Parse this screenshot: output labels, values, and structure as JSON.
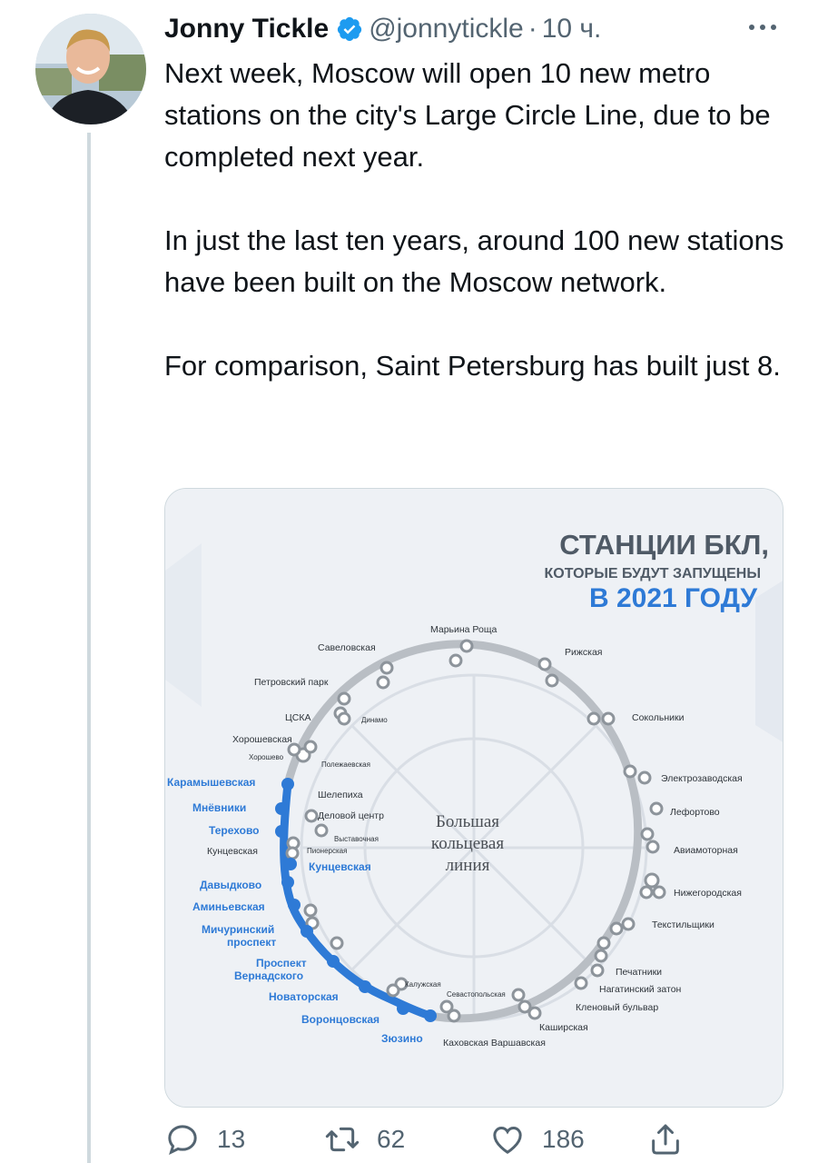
{
  "tweet": {
    "author_name": "Jonny Tickle",
    "handle": "@jonnytickle",
    "separator": "·",
    "time": "10 ч.",
    "paragraphs": [
      "Next week, Moscow will open 10 new metro stations on the city's Large Circle Line, due to be completed next year.",
      "In just the last ten years, around 100 new stations have been built on the Moscow network.",
      "For comparison, Saint Petersburg has built just 8."
    ]
  },
  "map": {
    "title_line1": "СТАНЦИИ БКЛ,",
    "title_line2": "КОТОРЫЕ БУДУТ ЗАПУЩЕНЫ",
    "title_line3": "В 2021 ГОДУ",
    "center_line1": "Большая",
    "center_line2": "кольцевая",
    "center_line3": "линия",
    "stations_existing": {
      "maryina_roshcha": "Марьина Роща",
      "savyolovskaya": "Савеловская",
      "rizhskaya": "Рижская",
      "petrovsky_park": "Петровский парк",
      "cska": "ЦСКА",
      "dinamo": "Динамо",
      "sokolniki": "Сокольники",
      "khoroshyovskaya": "Хорошевская",
      "khoroshyovo": "Хорошево",
      "polezhaevskaya": "Полежаевская",
      "elektrozavodskaya": "Электрозаводская",
      "shelepikha": "Шелепиха",
      "delovoy_tsentr": "Деловой центр",
      "lefortovo": "Лефортово",
      "vystavochnaya": "Выставочная",
      "pionerskaya": "Пионерская",
      "aviamotornaya": "Авиамоторная",
      "kuntsevskaya_small": "Кунцевская",
      "nizhegorodskaya": "Нижегородская",
      "tekstilshchiki": "Текстильщики",
      "pechatniki": "Печатники",
      "nagatinsky_zaton": "Нагатинский затон",
      "kaluzhskaya": "Калужская",
      "sevastopolskaya": "Севастопольская",
      "klenovy_bulvar": "Кленовый бульвар",
      "kashirskaya": "Каширская",
      "kakhovskaya_varshavskaya": "Каховская Варшавская"
    },
    "stations_new": {
      "karamyshevskaya": "Карамышевская",
      "mnyovniki": "Мнёвники",
      "terekhovo": "Терехово",
      "kuntsevskaya": "Кунцевская",
      "davydkovo": "Давыдково",
      "aminyevskaya": "Аминьевская",
      "michurinsky_1": "Мичуринский",
      "michurinsky_2": "проспект",
      "vernadskogo_1": "Проспект",
      "vernadskogo_2": "Вернадского",
      "novatorskaya": "Новаторская",
      "vorontsovskaya": "Воронцовская",
      "zyuzino": "Зюзино"
    }
  },
  "actions": {
    "reply_count": "13",
    "retweet_count": "62",
    "like_count": "186"
  },
  "colors": {
    "text": "#0f1419",
    "secondary": "#536471",
    "verified": "#1d9bf0",
    "line_new": "#2e7ad6",
    "line_existing": "#b9bec4"
  },
  "icons": [
    "verified-badge-icon",
    "more-icon",
    "reply-icon",
    "retweet-icon",
    "like-icon",
    "share-icon"
  ]
}
